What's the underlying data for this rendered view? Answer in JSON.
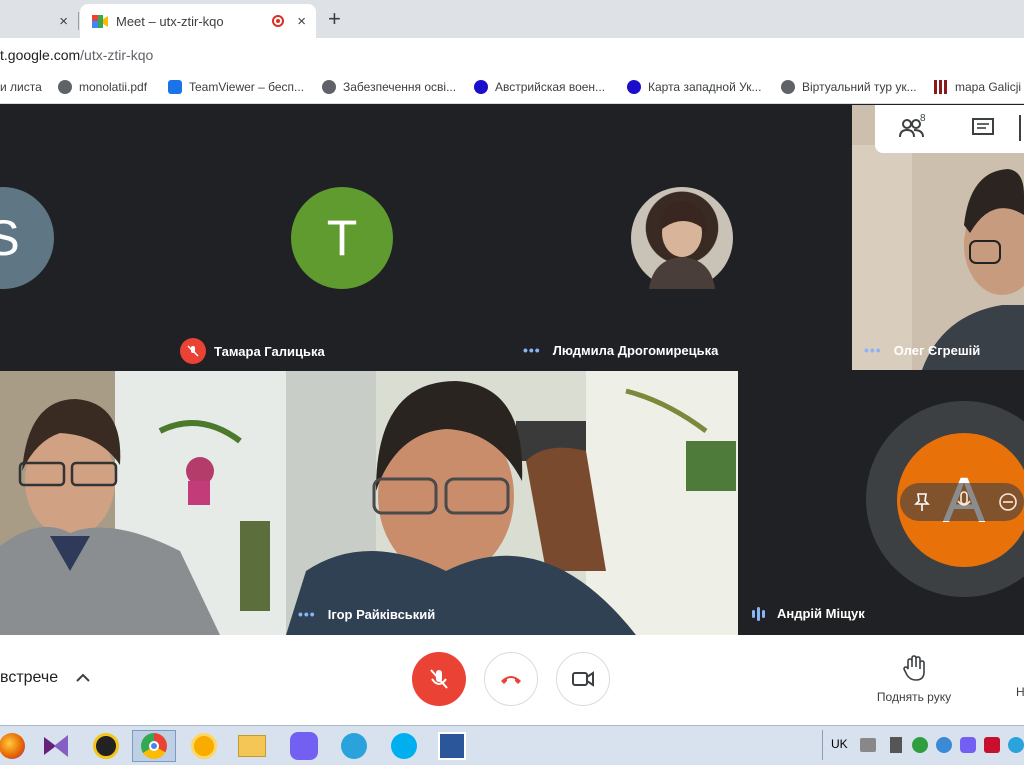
{
  "browser": {
    "inactive_tab_close": "×",
    "active_tab_title": "Meet – utx-ztir-kqo",
    "active_tab_close": "×",
    "new_tab": "+",
    "url_prefix": "t.google.com",
    "url_path": "/utx-ztir-kqo",
    "bookmarks": [
      {
        "label": "и листа",
        "icon": "none",
        "color": ""
      },
      {
        "label": "monolatii.pdf",
        "icon": "globe-icon",
        "color": "#5f6368"
      },
      {
        "label": "TeamViewer – бесп...",
        "icon": "teamviewer-icon",
        "color": "#1a73e8"
      },
      {
        "label": "Забезпечення осві...",
        "icon": "globe-icon",
        "color": "#5f6368"
      },
      {
        "label": "Австрийская воен...",
        "icon": "dot-icon",
        "color": "#1a0dcc"
      },
      {
        "label": "Карта западной Ук...",
        "icon": "dot-icon",
        "color": "#1a0dcc"
      },
      {
        "label": "Віртуальний тур ук...",
        "icon": "globe-icon",
        "color": "#5f6368"
      },
      {
        "label": "mapa Galicji",
        "icon": "grid-icon",
        "color": "#8b1a1a"
      }
    ]
  },
  "meet": {
    "participant_count_badge": "8",
    "participants": [
      {
        "name": "",
        "initial": "S",
        "color": "#5f7784"
      },
      {
        "name": "Тамара Галицька",
        "initial": "T",
        "color": "#5f9b2f",
        "muted": true
      },
      {
        "name": "Людмила Дрогомирецька",
        "initial": "",
        "color": "#7a6a60"
      },
      {
        "name": "Олег Єгрешій",
        "initial": "",
        "color": ""
      },
      {
        "name": "",
        "initial": "",
        "color": ""
      },
      {
        "name": "Ігор Райківський",
        "initial": "",
        "color": ""
      },
      {
        "name": "Андрій Міщук",
        "initial": "A",
        "color": "#e8710a"
      }
    ],
    "meeting_details_label": "встрече",
    "raise_hand_label": "Поднять руку",
    "more_label": "Н"
  },
  "taskbar": {
    "lang": "UK"
  },
  "colors": {
    "end_call": "#ea4335",
    "accent_blue": "#8ab4f8"
  }
}
